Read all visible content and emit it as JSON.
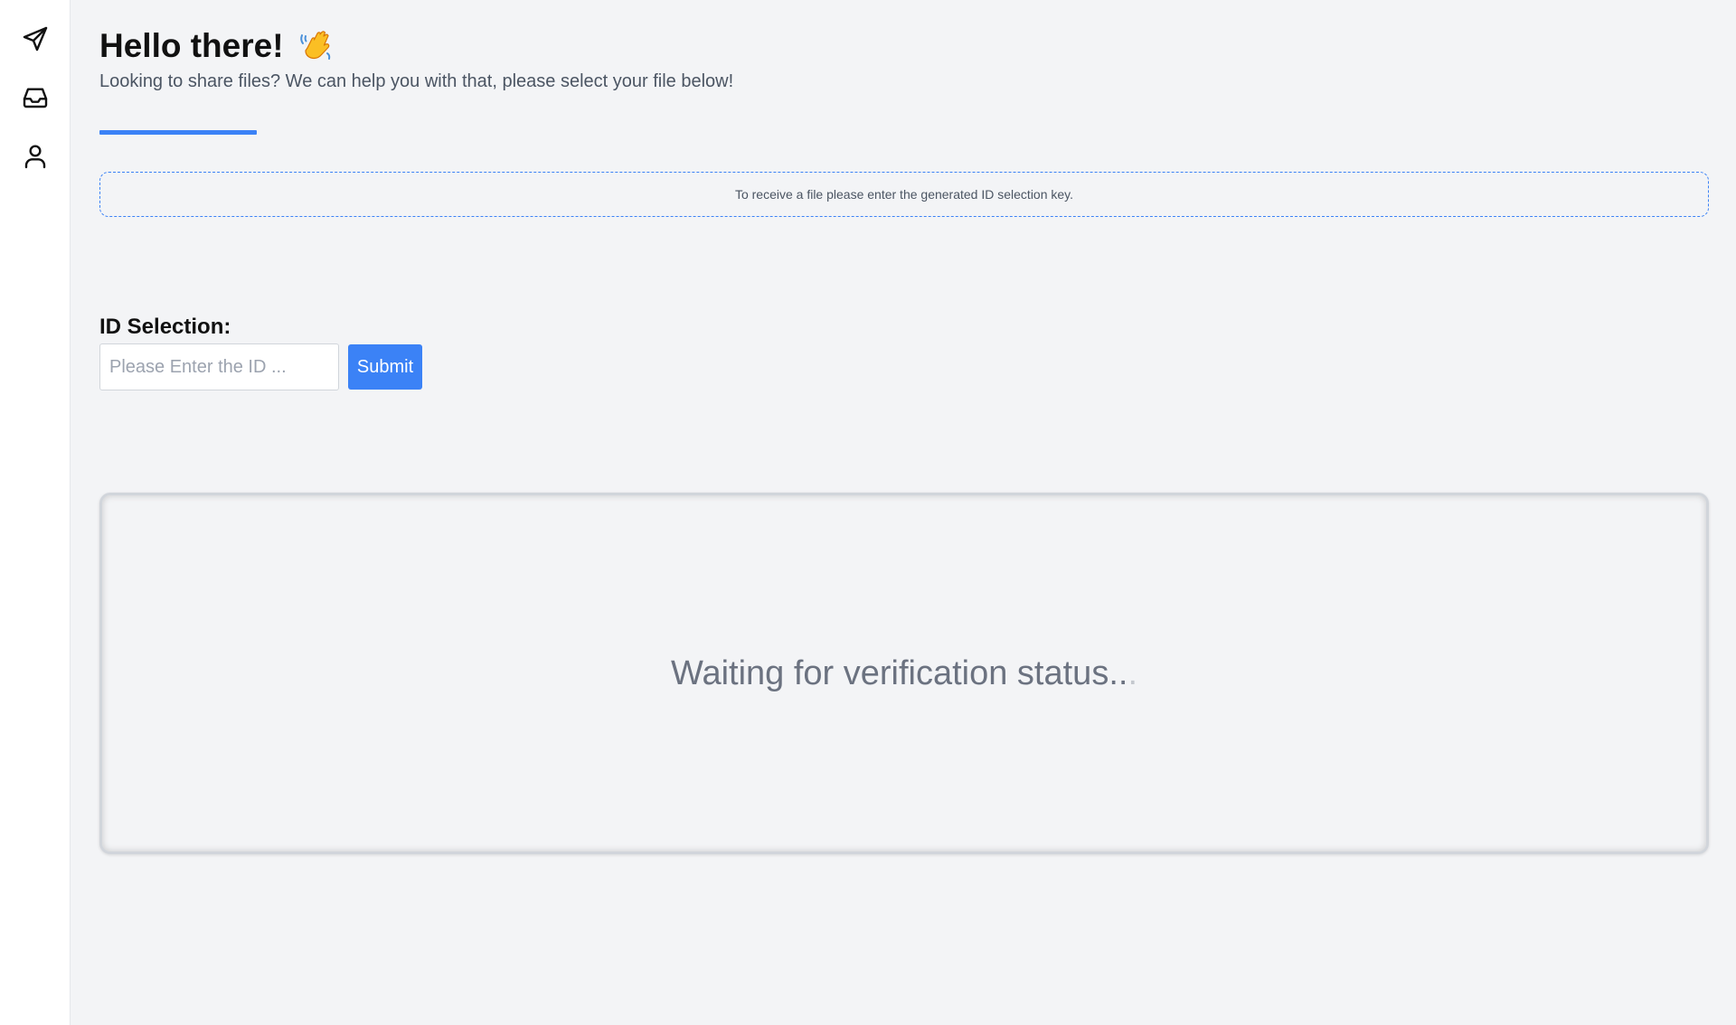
{
  "sidebar": {
    "items": [
      {
        "icon": "send-icon",
        "name": "send"
      },
      {
        "icon": "inbox-icon",
        "name": "receive"
      },
      {
        "icon": "user-icon",
        "name": "profile"
      }
    ]
  },
  "header": {
    "greeting": "Hello there!",
    "emoji": "waving-hand-icon",
    "subtitle": "Looking to share files? We can help you with that, please select your file below!"
  },
  "progress": {
    "fraction": 0.31
  },
  "info": {
    "text": "To receive a file please enter the generated ID selection key."
  },
  "id_form": {
    "label": "ID Selection:",
    "placeholder": "Please Enter the ID ...",
    "value": "",
    "submit_label": "Submit"
  },
  "status": {
    "text": "Waiting for verification status..",
    "trailing": "."
  },
  "colors": {
    "accent": "#3b82f6",
    "background": "#f3f4f6",
    "sidebar": "#ffffff"
  }
}
